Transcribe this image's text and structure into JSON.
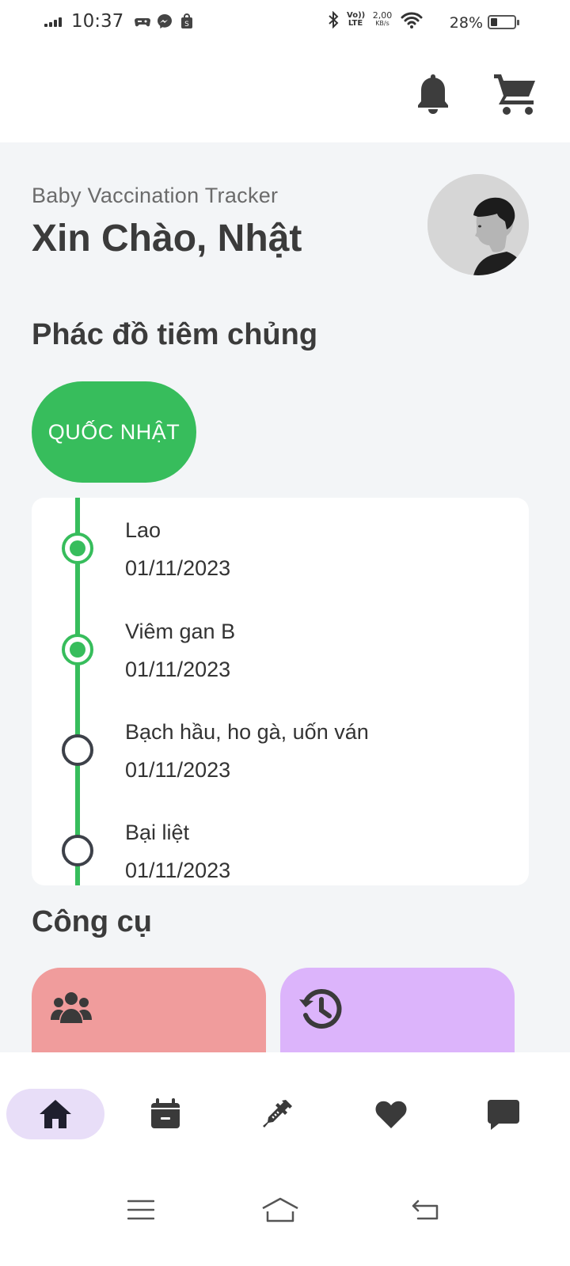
{
  "status_bar": {
    "time": "10:37",
    "network": "2,00\nKB/s",
    "network_speed": "2,00",
    "network_unit": "KB/s",
    "volte": "Vo))",
    "lte": "LTE",
    "battery_percent": "28%",
    "battery_level": 0.28
  },
  "header": {
    "subtitle": "Baby Vaccination Tracker",
    "greeting": "Xin Chào, Nhật"
  },
  "schedule": {
    "title": "Phác đồ tiêm chủng",
    "child_chip": "QUỐC NHẬT",
    "items": [
      {
        "name": "Lao",
        "date": "01/11/2023",
        "done": true
      },
      {
        "name": "Viêm gan B",
        "date": "01/11/2023",
        "done": true
      },
      {
        "name": "Bạch hầu, ho gà, uốn ván",
        "date": "01/11/2023",
        "done": false
      },
      {
        "name": "Bại liệt",
        "date": "01/11/2023",
        "done": false
      }
    ]
  },
  "tools": {
    "title": "Công cụ",
    "cards": [
      {
        "icon": "people-group-icon",
        "color": "#f09c9c"
      },
      {
        "icon": "history-icon",
        "color": "#dcb4fb"
      }
    ]
  },
  "bottom_nav": {
    "items": [
      {
        "icon": "home-icon",
        "active": true
      },
      {
        "icon": "calendar-icon",
        "active": false
      },
      {
        "icon": "syringe-icon",
        "active": false
      },
      {
        "icon": "heart-icon",
        "active": false
      },
      {
        "icon": "chat-icon",
        "active": false
      }
    ]
  },
  "colors": {
    "accent_green": "#37bd5c",
    "background": "#f3f5f7",
    "nav_active": "#e8def8"
  }
}
